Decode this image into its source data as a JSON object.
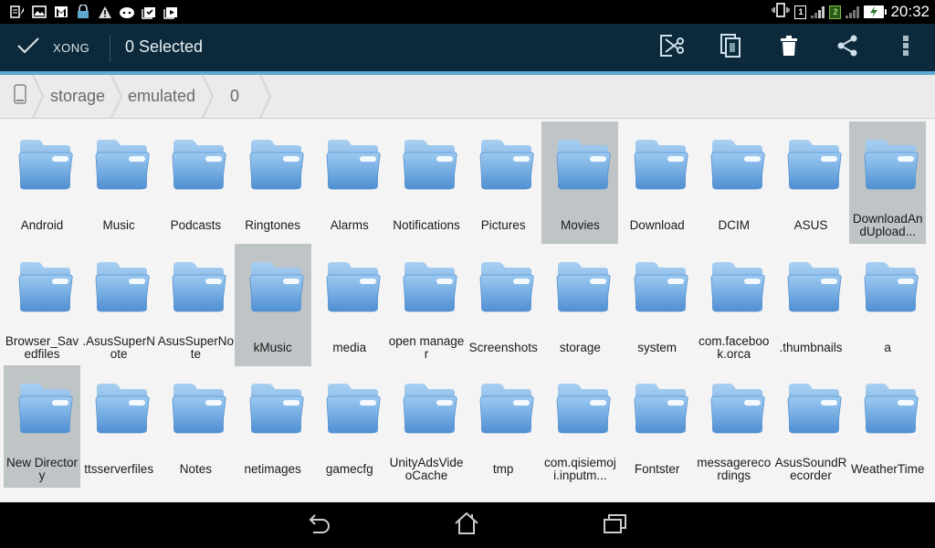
{
  "status_bar": {
    "left_icons": [
      "notes-icon",
      "gallery-icon",
      "gmail-icon",
      "lock-icon",
      "warning-icon",
      "android-icon",
      "screenshot-icon",
      "video-icon"
    ],
    "sim1_label": "1",
    "sim2_label": "2",
    "time": "20:32"
  },
  "action_bar": {
    "done_label": "XONG",
    "title": "0 Selected",
    "actions": [
      {
        "name": "cut-icon",
        "label": "Cut"
      },
      {
        "name": "copy-icon",
        "label": "Copy"
      },
      {
        "name": "delete-icon",
        "label": "Delete"
      },
      {
        "name": "share-icon",
        "label": "Share"
      },
      {
        "name": "more-options-icon",
        "label": "More options"
      }
    ]
  },
  "breadcrumb": {
    "root_icon": "phone-icon",
    "items": [
      "storage",
      "emulated",
      "0"
    ]
  },
  "folders": [
    {
      "name": "Android",
      "selected": false
    },
    {
      "name": "Music",
      "selected": false
    },
    {
      "name": "Podcasts",
      "selected": false
    },
    {
      "name": "Ringtones",
      "selected": false
    },
    {
      "name": "Alarms",
      "selected": false
    },
    {
      "name": "Notifications",
      "selected": false
    },
    {
      "name": "Pictures",
      "selected": false
    },
    {
      "name": "Movies",
      "selected": true
    },
    {
      "name": "Download",
      "selected": false
    },
    {
      "name": "DCIM",
      "selected": false
    },
    {
      "name": "ASUS",
      "selected": false
    },
    {
      "name": "DownloadAndUpload...",
      "selected": true
    },
    {
      "name": "Browser_Savedfiles",
      "selected": false
    },
    {
      "name": ".AsusSuperNote",
      "selected": false
    },
    {
      "name": "AsusSuperNote",
      "selected": false
    },
    {
      "name": "kMusic",
      "selected": true
    },
    {
      "name": "media",
      "selected": false
    },
    {
      "name": "open manager",
      "selected": false
    },
    {
      "name": "Screenshots",
      "selected": false
    },
    {
      "name": "storage",
      "selected": false
    },
    {
      "name": "system",
      "selected": false
    },
    {
      "name": "com.facebook.orca",
      "selected": false
    },
    {
      "name": ".thumbnails",
      "selected": false
    },
    {
      "name": "a",
      "selected": false
    },
    {
      "name": "New Directory",
      "selected": true
    },
    {
      "name": "ttsserverfiles",
      "selected": false
    },
    {
      "name": "Notes",
      "selected": false
    },
    {
      "name": "netimages",
      "selected": false
    },
    {
      "name": "gamecfg",
      "selected": false
    },
    {
      "name": "UnityAdsVideoCache",
      "selected": false
    },
    {
      "name": "tmp",
      "selected": false
    },
    {
      "name": "com.qisiemoji.inputm...",
      "selected": false
    },
    {
      "name": "Fontster",
      "selected": false
    },
    {
      "name": "messagerecordings",
      "selected": false
    },
    {
      "name": "AsusSoundRecorder",
      "selected": false
    },
    {
      "name": "WeatherTime",
      "selected": false
    }
  ],
  "nav_bar": {
    "buttons": [
      "back-icon",
      "home-icon",
      "recent-apps-icon"
    ]
  },
  "colors": {
    "action_bar": "#0c2a3b",
    "accent": "#5fa8d3",
    "selected_tile": "#bfc4c6",
    "folder_blue": "#6fa8dc"
  }
}
